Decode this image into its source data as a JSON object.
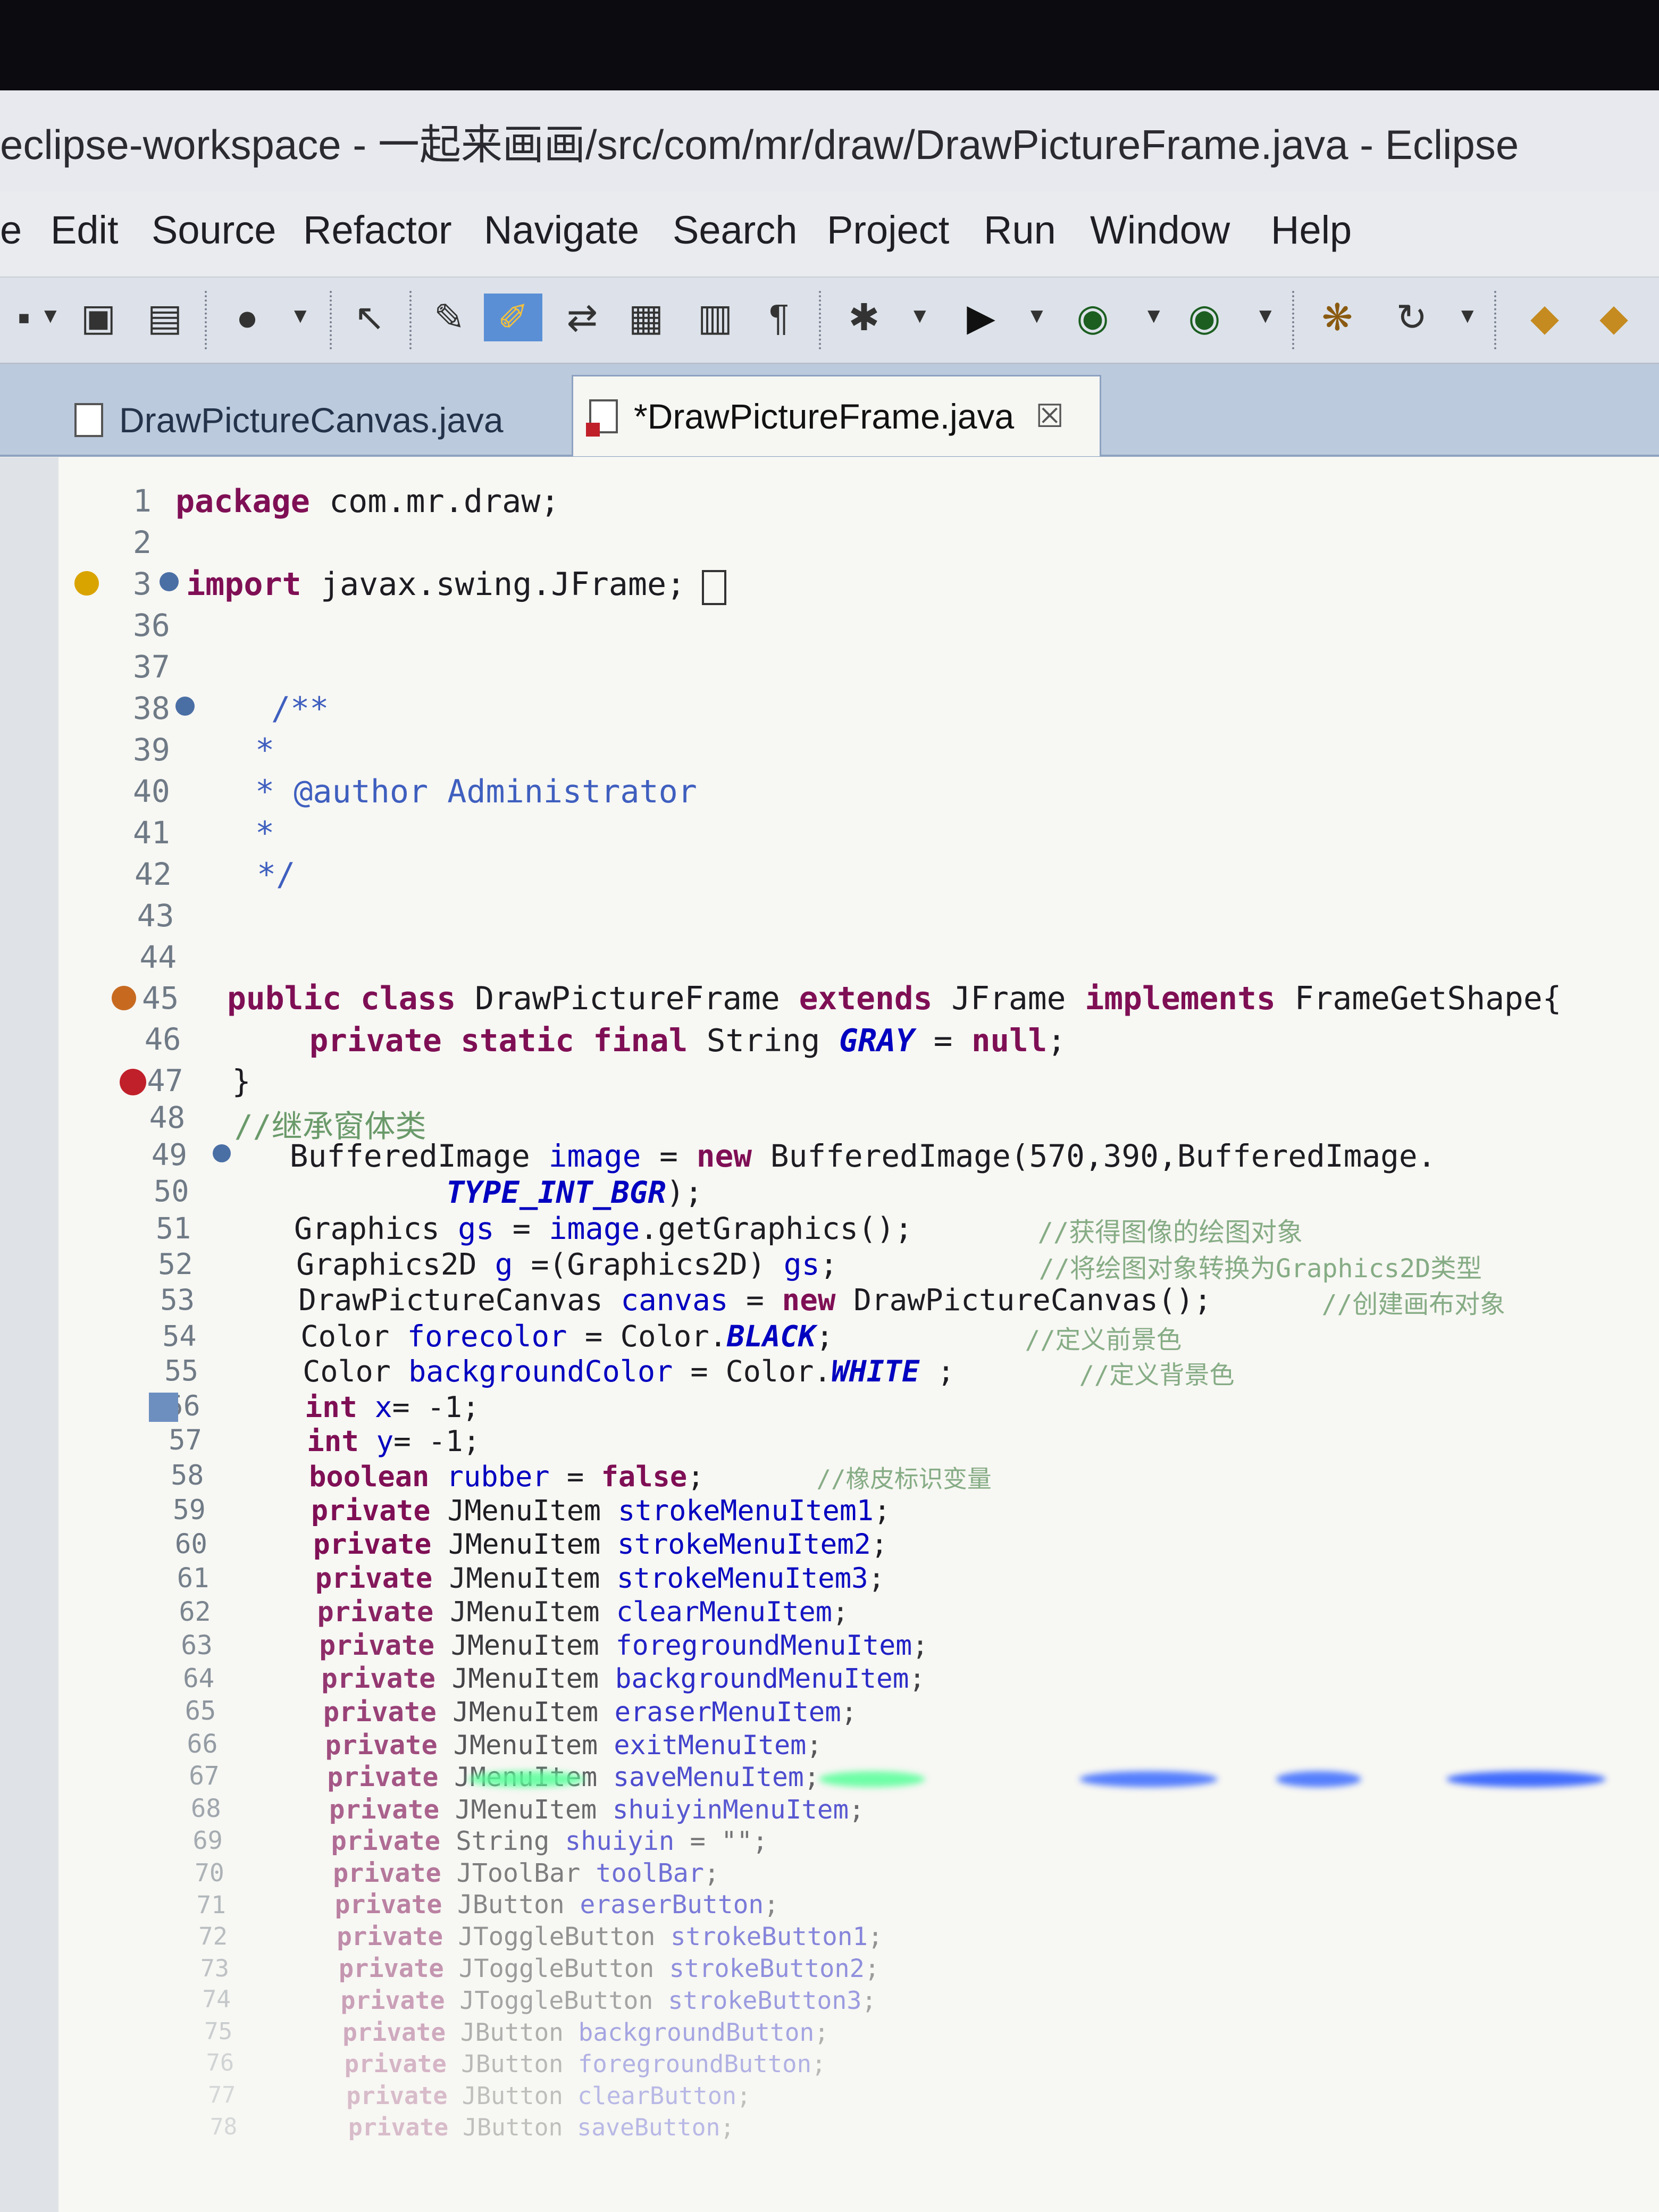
{
  "window": {
    "title": "eclipse-workspace - 一起来画画/src/com/mr/draw/DrawPictureFrame.java - Eclipse"
  },
  "menubar": {
    "items": [
      "e",
      "Edit",
      "Source",
      "Refactor",
      "Navigate",
      "Search",
      "Project",
      "Run",
      "Window",
      "Help"
    ]
  },
  "toolbar": {
    "icons": [
      "new-icon",
      "save-icon",
      "save-all-icon",
      "globe-icon",
      "pointer-icon",
      "annotation-icon",
      "highlight-icon",
      "step-icon",
      "open-type-icon",
      "outline-icon",
      "paragraph-icon",
      "debug-icon",
      "run-icon",
      "run-config-icon",
      "external-tool-icon",
      "ant-icon",
      "refresh-icon",
      "open-folder-icon",
      "export-icon"
    ]
  },
  "tabs": [
    {
      "label": "DrawPictureCanvas.java",
      "active": false
    },
    {
      "label": "*DrawPictureFrame.java",
      "active": true,
      "close": "☒"
    }
  ],
  "code": {
    "lines": [
      {
        "num": "1",
        "text": "package com.mr.draw;"
      },
      {
        "num": "2",
        "text": ""
      },
      {
        "num": "3",
        "text": "import javax.swing.JFrame;"
      },
      {
        "num": "36",
        "text": ""
      },
      {
        "num": "37",
        "text": ""
      },
      {
        "num": "38",
        "text": "/**"
      },
      {
        "num": "39",
        "text": "*"
      },
      {
        "num": "40",
        "text": "* @author Administrator"
      },
      {
        "num": "41",
        "text": "*"
      },
      {
        "num": "42",
        "text": "*/"
      },
      {
        "num": "43",
        "text": ""
      },
      {
        "num": "44",
        "text": ""
      },
      {
        "num": "45",
        "text": "public class DrawPictureFrame extends JFrame implements FrameGetShape{"
      },
      {
        "num": "46",
        "text": "private static final String GRAY = null;"
      },
      {
        "num": "47",
        "text": "}"
      },
      {
        "num": "48",
        "text": "//继承窗体类"
      },
      {
        "num": "49",
        "text": "BufferedImage image = new BufferedImage(570,390,BufferedImage."
      },
      {
        "num": "50",
        "text": "TYPE_INT_BGR);"
      },
      {
        "num": "51",
        "text": "Graphics gs = image.getGraphics();"
      },
      {
        "num": "52",
        "text": "Graphics2D g =(Graphics2D) gs;"
      },
      {
        "num": "53",
        "text": "DrawPictureCanvas canvas = new DrawPictureCanvas();"
      },
      {
        "num": "54",
        "text": "Color forecolor = Color.BLACK;"
      },
      {
        "num": "55",
        "text": "Color backgroundColor = Color.WHITE ;"
      },
      {
        "num": "56",
        "text": "int x= -1;"
      },
      {
        "num": "57",
        "text": "int y= -1;"
      },
      {
        "num": "58",
        "text": "boolean rubber = false;"
      },
      {
        "num": "59",
        "text": "private JMenuItem strokeMenuItem1;"
      },
      {
        "num": "60",
        "text": "private JMenuItem strokeMenuItem2;"
      },
      {
        "num": "61",
        "text": "private JMenuItem strokeMenuItem3;"
      },
      {
        "num": "62",
        "text": "private JMenuItem clearMenuItem;"
      },
      {
        "num": "63",
        "text": "private JMenuItem foregroundMenuItem;"
      },
      {
        "num": "64",
        "text": "private JMenuItem backgroundMenuItem;"
      },
      {
        "num": "65",
        "text": "private JMenuItem eraserMenuItem;"
      },
      {
        "num": "66",
        "text": "private JMenuItem exitMenuItem;"
      },
      {
        "num": "67",
        "text": "private JMenuItem saveMenuItem;"
      },
      {
        "num": "68",
        "text": "private JMenuItem shuiyinMenuItem;"
      },
      {
        "num": "69",
        "text": "private String shuiyin = \"\";"
      },
      {
        "num": "70",
        "text": "private JToolBar toolBar;"
      },
      {
        "num": "71",
        "text": "private JButton eraserButton;"
      },
      {
        "num": "72",
        "text": "private JToggleButton strokeButton1;"
      },
      {
        "num": "73",
        "text": "private JToggleButton strokeButton2;"
      },
      {
        "num": "74",
        "text": "private JToggleButton strokeButton3;"
      },
      {
        "num": "75",
        "text": "private JButton backgroundButton;"
      },
      {
        "num": "76",
        "text": "private JButton foregroundButton;"
      },
      {
        "num": "77",
        "text": "private JButton clearButton;"
      },
      {
        "num": "78",
        "text": "private JButton saveButton;"
      }
    ],
    "comments": [
      {
        "line": "51",
        "text": "//获得图像的绘图对象"
      },
      {
        "line": "52",
        "text": "//将绘图对象转换为Graphics2D类型"
      },
      {
        "line": "53",
        "text": "//创建画布对象"
      },
      {
        "line": "54",
        "text": "//定义前景色"
      },
      {
        "line": "55",
        "text": "//定义背景色"
      },
      {
        "line": "58",
        "text": "//橡皮标识变量"
      }
    ]
  },
  "colors": {
    "keyword": "#7f0f55",
    "javadoc": "#3f5fbf",
    "field": "#0000c0",
    "comment": "#6a9a6a",
    "error": "#c0202a"
  }
}
